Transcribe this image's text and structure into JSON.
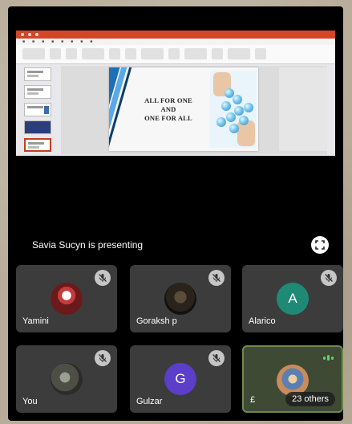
{
  "presentation": {
    "slide_text_lines": [
      "ALL FOR ONE",
      "AND",
      "ONE FOR ALL"
    ],
    "presenter_status": "Savia Sucyn is presenting"
  },
  "participants": [
    {
      "name": "Yamini",
      "type": "photo",
      "muted": true
    },
    {
      "name": "Goraksh p",
      "type": "photo",
      "muted": true
    },
    {
      "name": "Alarico",
      "type": "initial",
      "initial": "A",
      "color": "#1e8a75",
      "muted": true
    },
    {
      "name": "You",
      "type": "photo",
      "muted": true
    },
    {
      "name": "Gulzar",
      "type": "initial",
      "initial": "G",
      "color": "#5b3ec9",
      "muted": true
    },
    {
      "name": "£",
      "type": "photo",
      "others_label": "23 others",
      "speaking": true
    }
  ],
  "icons": {
    "mute": "mic-off-icon",
    "fullscreen": "fullscreen-icon",
    "speaking": "audio-level-icon"
  },
  "colors": {
    "tile_bg": "#3c3c3c",
    "active_border": "#6f8a4a",
    "powerpoint": "#d24726"
  }
}
